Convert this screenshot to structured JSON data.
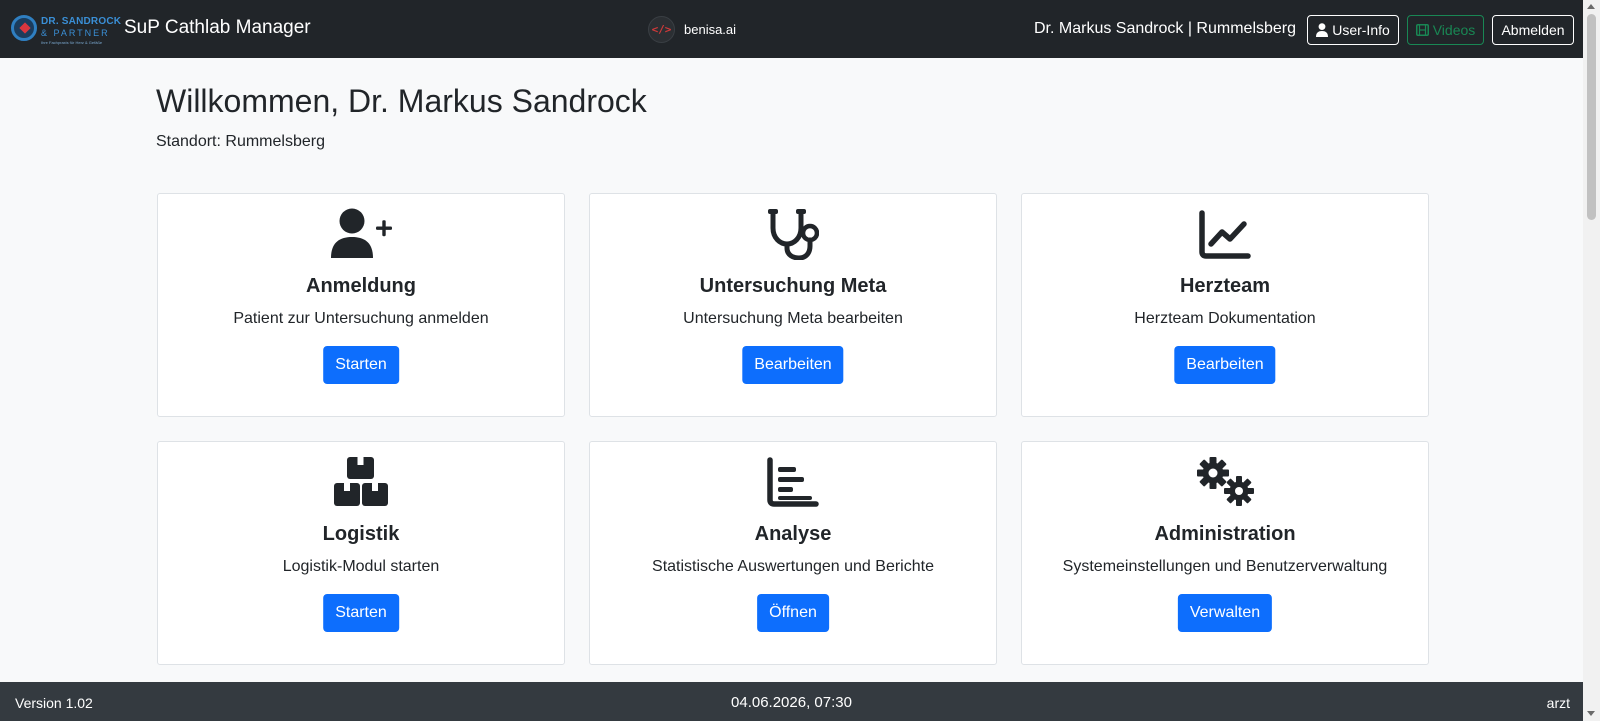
{
  "navbar": {
    "logo": {
      "line1": "DR. SANDROCK",
      "line2": "& PARTNER",
      "line3": "Ihre Fachpraxis für Herz & Gefäße"
    },
    "app_title": "SuP Cathlab Manager",
    "center_brand": "benisa.ai",
    "center_icon_glyph": "</>",
    "user_line": "Dr. Markus Sandrock | Rummelsberg",
    "buttons": {
      "user_info": "User-Info",
      "videos": "Videos",
      "logout": "Abmelden"
    }
  },
  "main": {
    "welcome": "Willkommen, Dr. Markus Sandrock",
    "location_label": "Standort:",
    "location_value": "Rummelsberg",
    "cards": [
      {
        "icon": "user-plus-icon",
        "title": "Anmeldung",
        "text": "Patient zur Untersuchung anmelden",
        "button": "Starten"
      },
      {
        "icon": "stethoscope-icon",
        "title": "Untersuchung Meta",
        "text": "Untersuchung Meta bearbeiten",
        "button": "Bearbeiten"
      },
      {
        "icon": "chart-line-icon",
        "title": "Herzteam",
        "text": "Herzteam Dokumentation",
        "button": "Bearbeiten"
      },
      {
        "icon": "boxes-icon",
        "title": "Logistik",
        "text": "Logistik-Modul starten",
        "button": "Starten"
      },
      {
        "icon": "chart-bars-icon",
        "title": "Analyse",
        "text": "Statistische Auswertungen und Berichte",
        "button": "Öffnen"
      },
      {
        "icon": "gears-icon",
        "title": "Administration",
        "text": "Systemeinstellungen und Benutzerverwaltung",
        "button": "Verwalten"
      }
    ]
  },
  "footer": {
    "version": "Version 1.02",
    "datetime": "04.06.2026, 07:30",
    "role": "arzt"
  },
  "colors": {
    "navbar_bg": "#212529",
    "footer_bg": "#343a40",
    "primary": "#0d6efd",
    "success": "#198754",
    "page_bg": "#f8f9fa",
    "benisa_red": "#d13a3a"
  }
}
